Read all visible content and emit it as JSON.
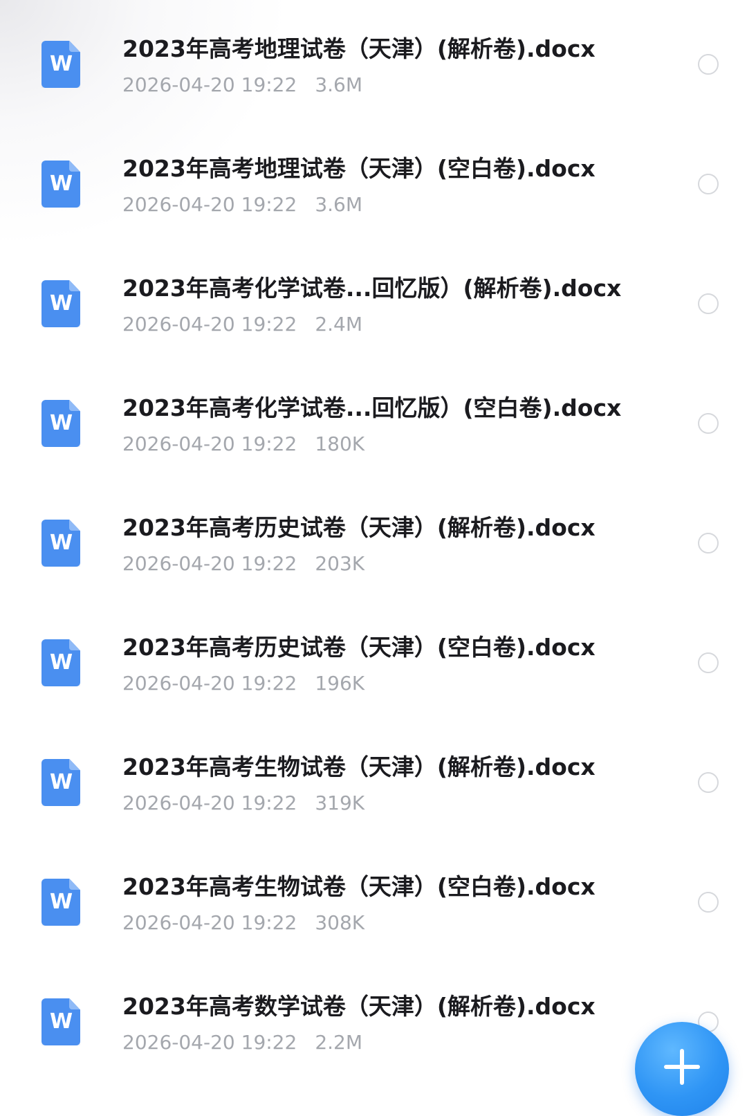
{
  "files": [
    {
      "name": "2023年高考地理试卷（天津）(解析卷).docx",
      "date": "2026-04-20 19:22",
      "size": "3.6M",
      "icon": "word-doc-icon",
      "icon_letter": "W",
      "selected": false
    },
    {
      "name": "2023年高考地理试卷（天津）(空白卷).docx",
      "date": "2026-04-20 19:22",
      "size": "3.6M",
      "icon": "word-doc-icon",
      "icon_letter": "W",
      "selected": false
    },
    {
      "name": "2023年高考化学试卷...回忆版）(解析卷).docx",
      "date": "2026-04-20 19:22",
      "size": "2.4M",
      "icon": "word-doc-icon",
      "icon_letter": "W",
      "selected": false
    },
    {
      "name": "2023年高考化学试卷...回忆版）(空白卷).docx",
      "date": "2026-04-20 19:22",
      "size": "180K",
      "icon": "word-doc-icon",
      "icon_letter": "W",
      "selected": false
    },
    {
      "name": "2023年高考历史试卷（天津）(解析卷).docx",
      "date": "2026-04-20 19:22",
      "size": "203K",
      "icon": "word-doc-icon",
      "icon_letter": "W",
      "selected": false
    },
    {
      "name": "2023年高考历史试卷（天津）(空白卷).docx",
      "date": "2026-04-20 19:22",
      "size": "196K",
      "icon": "word-doc-icon",
      "icon_letter": "W",
      "selected": false
    },
    {
      "name": "2023年高考生物试卷（天津）(解析卷).docx",
      "date": "2026-04-20 19:22",
      "size": "319K",
      "icon": "word-doc-icon",
      "icon_letter": "W",
      "selected": false
    },
    {
      "name": "2023年高考生物试卷（天津）(空白卷).docx",
      "date": "2026-04-20 19:22",
      "size": "308K",
      "icon": "word-doc-icon",
      "icon_letter": "W",
      "selected": false
    },
    {
      "name": "2023年高考数学试卷（天津）(解析卷).docx",
      "date": "2026-04-20 19:22",
      "size": "2.2M",
      "icon": "word-doc-icon",
      "icon_letter": "W",
      "selected": false
    }
  ],
  "fab": {
    "icon": "plus-icon"
  },
  "colors": {
    "title_text": "#1b1b1f",
    "meta_text": "#a4a7ad",
    "word_icon": "#4a8ff0",
    "radio_border": "#d6d8dc",
    "fab": "#2f95f5"
  }
}
